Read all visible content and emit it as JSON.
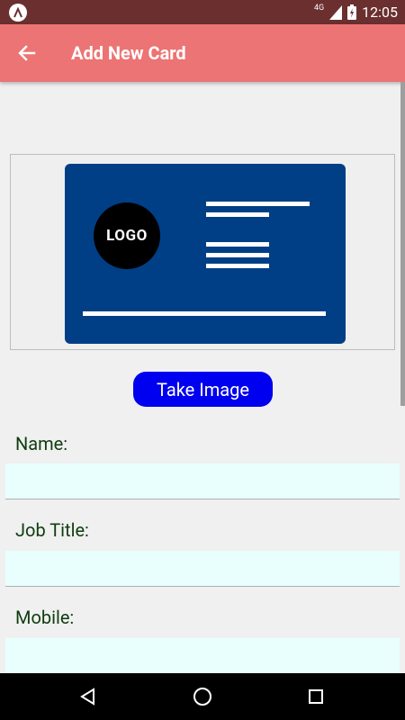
{
  "status_bar": {
    "time": "12:05",
    "network": "4G"
  },
  "app_bar": {
    "title": "Add New Card",
    "background": "#ec7474"
  },
  "card_preview": {
    "logo_text": "LOGO",
    "card_color": "#003f85"
  },
  "actions": {
    "take_image_label": "Take Image",
    "button_color": "#0000f0"
  },
  "form": {
    "fields": [
      {
        "label": "Name:",
        "value": ""
      },
      {
        "label": "Job Title:",
        "value": ""
      },
      {
        "label": "Mobile:",
        "value": ""
      }
    ]
  },
  "icons": {
    "back": "arrow-left-icon",
    "nav_back": "triangle-back-icon",
    "nav_home": "circle-home-icon",
    "nav_recents": "square-recents-icon"
  }
}
